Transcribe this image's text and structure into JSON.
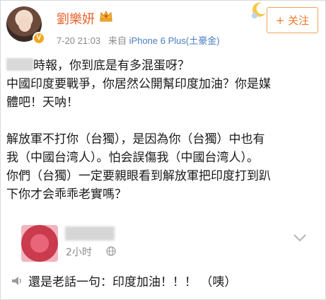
{
  "post": {
    "username": "劉樂妍",
    "time": "7-20 21:03",
    "source_prefix": "来自",
    "device": "iPhone 6 Plus(土豪金)",
    "follow_label": "+ 关注"
  },
  "content": {
    "line1_suffix": "時報，你到底是有多混蛋呀？",
    "line2": "中國印度要戰爭，你居然公開幫印度加油？你是媒",
    "line3": "體吧！天呐！",
    "line4": "解放軍不打你（台獨），是因為你（台獨）中也有",
    "line5": "我（中國台湾人）。怕会誤傷我（中國台湾人）。",
    "line6": "你們（台獨）一定要親眼看到解放軍把印度打到趴",
    "line7": "下你才会乖乖老實嗎？"
  },
  "card": {
    "time": "2小时"
  },
  "note": {
    "text": "還是老話一句：印度加油！！！ （咦）"
  },
  "colors": {
    "username": "#e8632a",
    "link": "#4a7cc4",
    "follow": "#ee7a28"
  }
}
